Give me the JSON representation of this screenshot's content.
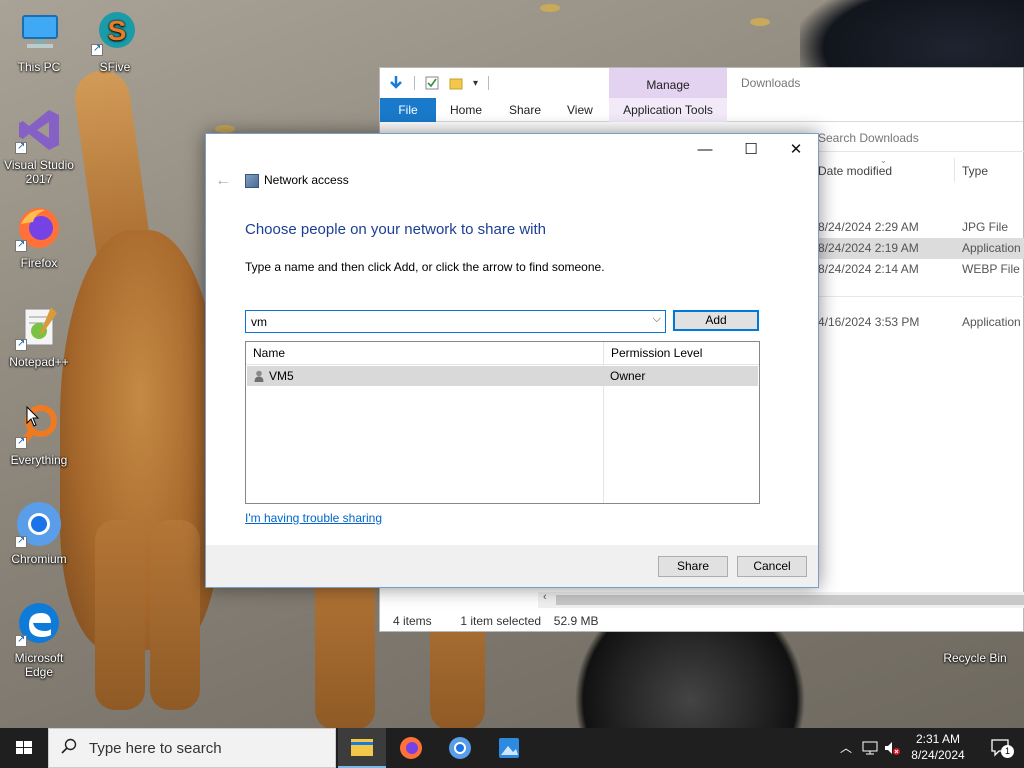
{
  "desktop": {
    "icons": [
      {
        "label": "This PC",
        "icon": "this-pc-icon"
      },
      {
        "label": "SFive",
        "icon": "sfive-icon"
      },
      {
        "label": "Visual Studio 2017",
        "icon": "visual-studio-icon"
      },
      {
        "label": "Firefox",
        "icon": "firefox-icon"
      },
      {
        "label": "Notepad++",
        "icon": "notepad-plus-plus-icon"
      },
      {
        "label": "Everything",
        "icon": "everything-icon"
      },
      {
        "label": "Chromium",
        "icon": "chromium-icon"
      },
      {
        "label": "Microsoft Edge",
        "icon": "edge-icon"
      },
      {
        "label": "Recycle Bin",
        "icon": "recycle-bin-icon"
      }
    ]
  },
  "explorer": {
    "title": "Downloads",
    "manage_tab": "Manage",
    "tabs": {
      "file": "File",
      "home": "Home",
      "share": "Share",
      "view": "View",
      "app_tools": "Application Tools"
    },
    "search_placeholder": "Search Downloads",
    "columns": {
      "date": "Date modified",
      "type": "Type"
    },
    "rows": [
      {
        "date": "8/24/2024 2:29 AM",
        "type": "JPG File",
        "selected": false
      },
      {
        "date": "8/24/2024 2:19 AM",
        "type": "Application",
        "selected": true
      },
      {
        "date": "8/24/2024 2:14 AM",
        "type": "WEBP File",
        "selected": false
      },
      {
        "date": "4/16/2024 3:53 PM",
        "type": "Application",
        "selected": false
      }
    ],
    "status": {
      "items": "4 items",
      "selected": "1 item selected",
      "size": "52.9 MB"
    }
  },
  "dialog": {
    "title": "Network access",
    "heading": "Choose people on your network to share with",
    "instructions": "Type a name and then click Add, or click the arrow to find someone.",
    "input_value": "vm",
    "add_label": "Add",
    "list_columns": {
      "name": "Name",
      "permission": "Permission Level"
    },
    "list_rows": [
      {
        "name": "VM5",
        "permission": "Owner"
      }
    ],
    "trouble_link": "I'm having trouble sharing",
    "share_label": "Share",
    "cancel_label": "Cancel",
    "controls": {
      "minimize": "—",
      "maximize": "☐",
      "close": "✕"
    }
  },
  "taskbar": {
    "search_placeholder": "Type here to search",
    "apps": [
      "file-explorer-icon",
      "firefox-icon",
      "chromium-icon",
      "photos-icon"
    ],
    "clock_time": "2:31 AM",
    "clock_date": "8/24/2024",
    "notification_count": "1"
  },
  "colors": {
    "accent": "#0078d7",
    "heading_blue": "#1c3f94",
    "link_blue": "#0066cc",
    "manage_purple": "#e3d2f0",
    "taskbar": "#1f1f1f"
  }
}
